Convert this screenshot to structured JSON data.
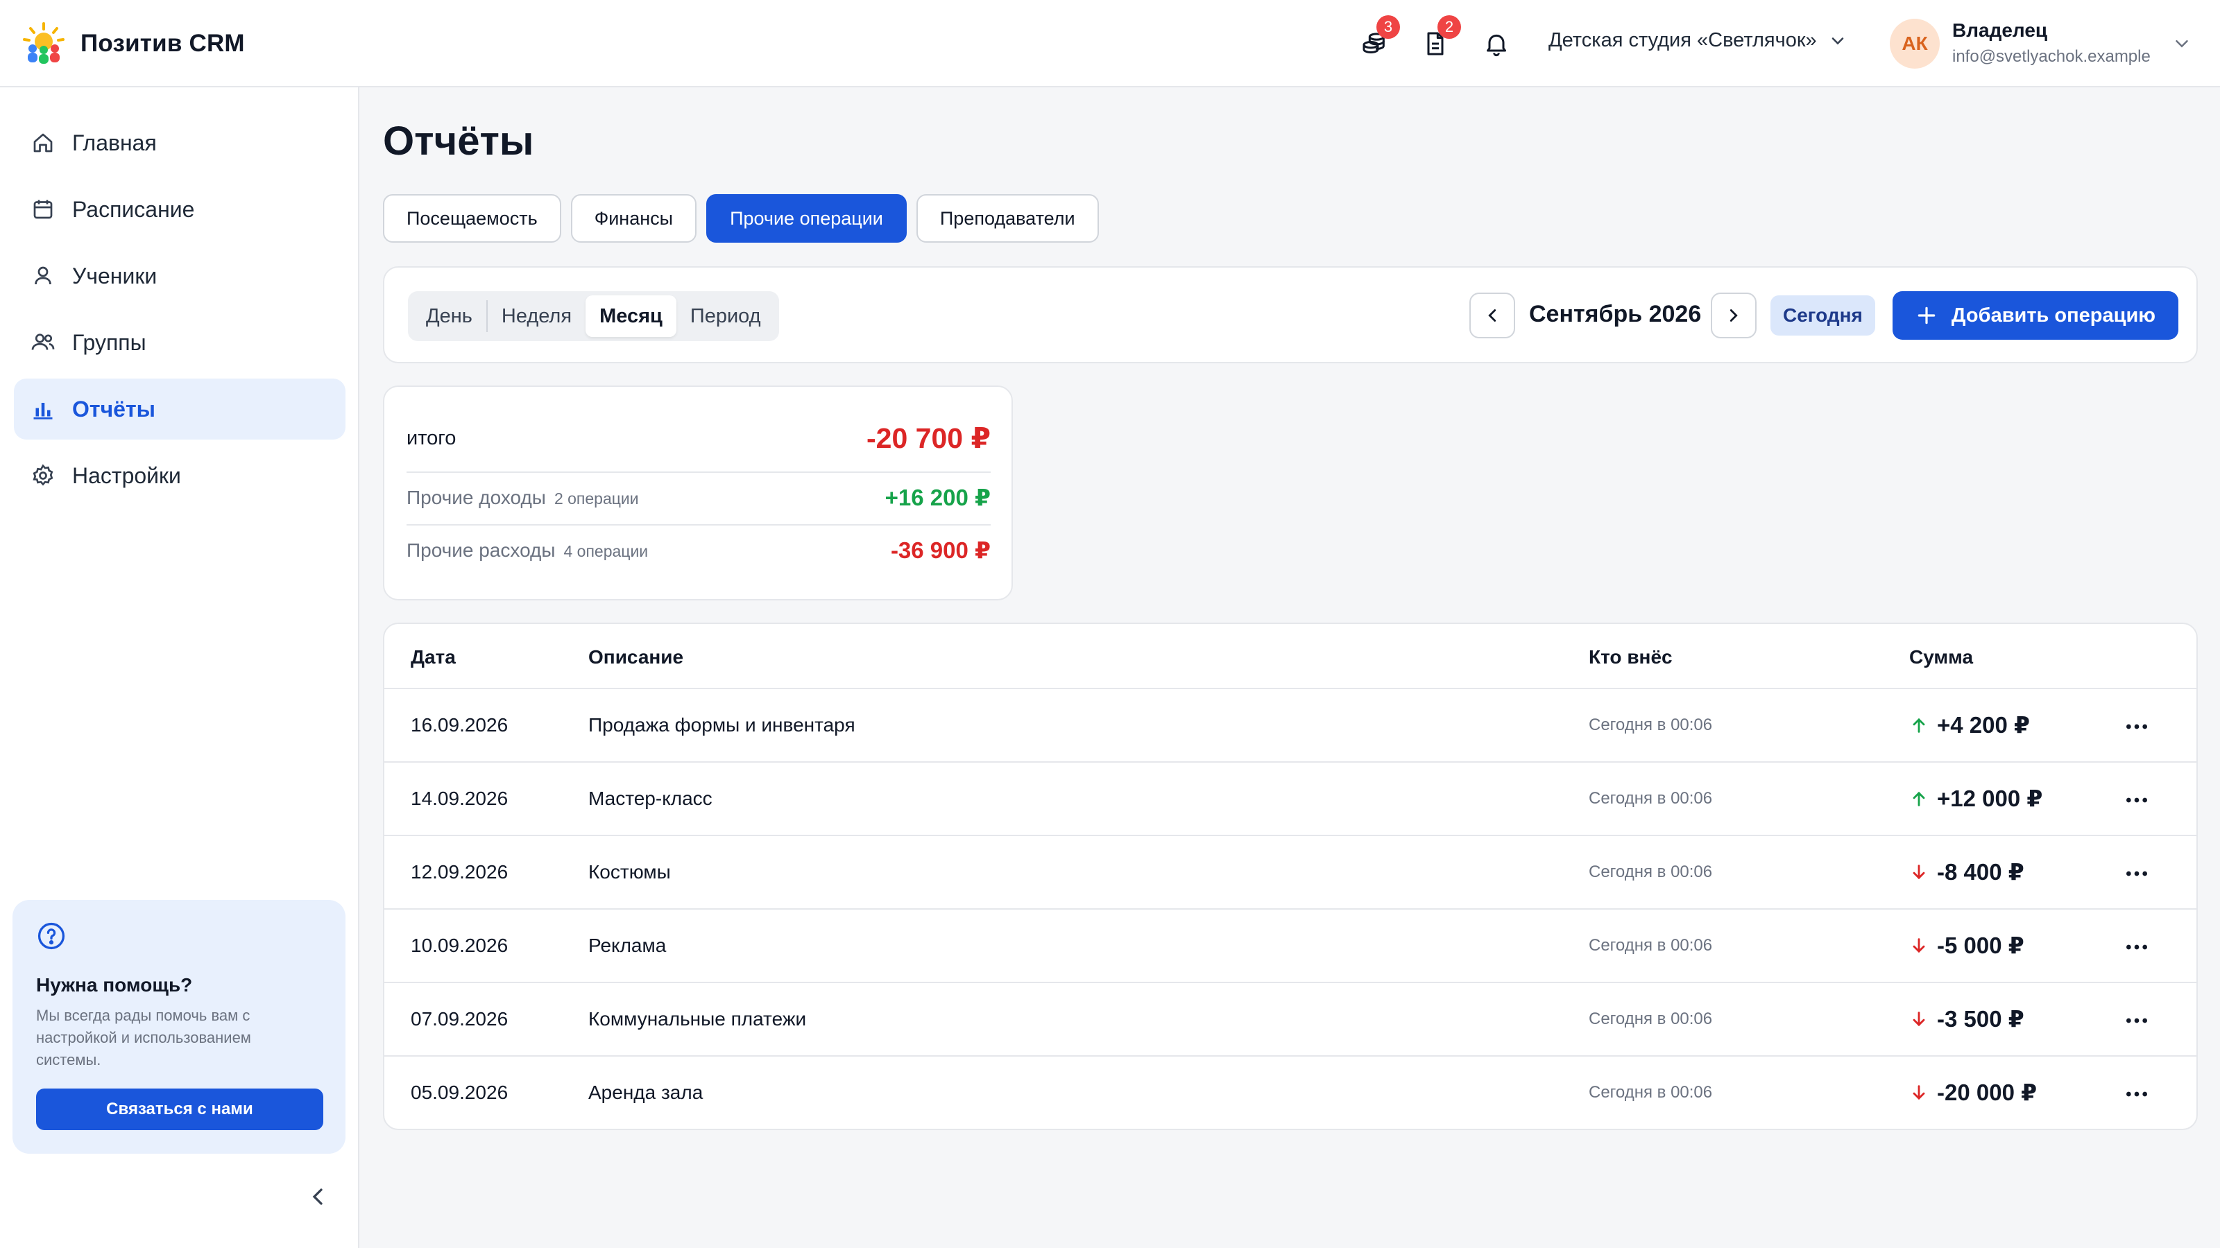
{
  "header": {
    "brand": "Позитив CRM",
    "badges": {
      "payments": "3",
      "documents": "2"
    },
    "studio": "Детская студия «Светлячок»",
    "avatar_initials": "АК",
    "user_name": "Владелец",
    "user_email": "info@svetlyachok.example"
  },
  "sidebar": {
    "items": [
      {
        "label": "Главная",
        "icon": "home-icon"
      },
      {
        "label": "Расписание",
        "icon": "calendar-icon"
      },
      {
        "label": "Ученики",
        "icon": "user-icon"
      },
      {
        "label": "Группы",
        "icon": "users-icon"
      },
      {
        "label": "Отчёты",
        "icon": "chart-icon"
      },
      {
        "label": "Настройки",
        "icon": "gear-icon"
      }
    ],
    "active_index": 4,
    "help": {
      "title": "Нужна помощь?",
      "text": "Мы всегда рады помочь вам с настройкой и использованием системы.",
      "button": "Связаться с нами"
    }
  },
  "page": {
    "title": "Отчёты",
    "tabs": [
      "Посещаемость",
      "Финансы",
      "Прочие операции",
      "Преподаватели"
    ],
    "active_tab": 2
  },
  "toolbar": {
    "periods": [
      "День",
      "Неделя",
      "Месяц",
      "Период"
    ],
    "active_period": 2,
    "month": "Сентябрь 2026",
    "today": "Сегодня",
    "add": "Добавить операцию"
  },
  "summary": {
    "total_label": "итого",
    "total_value": "-20 700 ₽",
    "income_label": "Прочие доходы",
    "income_count": "2 операции",
    "income_value": "+16 200 ₽",
    "expense_label": "Прочие расходы",
    "expense_count": "4 операции",
    "expense_value": "-36 900 ₽"
  },
  "table": {
    "columns": [
      "Дата",
      "Описание",
      "Кто внёс",
      "Сумма"
    ],
    "rows": [
      {
        "date": "16.09.2026",
        "desc": "Продажа формы и инвентаря",
        "by": "Сегодня в 00:06",
        "amount": "+4 200 ₽",
        "dir": "up"
      },
      {
        "date": "14.09.2026",
        "desc": "Мастер-класс",
        "by": "Сегодня в 00:06",
        "amount": "+12 000 ₽",
        "dir": "up"
      },
      {
        "date": "12.09.2026",
        "desc": "Костюмы",
        "by": "Сегодня в 00:06",
        "amount": "-8 400 ₽",
        "dir": "down"
      },
      {
        "date": "10.09.2026",
        "desc": "Реклама",
        "by": "Сегодня в 00:06",
        "amount": "-5 000 ₽",
        "dir": "down"
      },
      {
        "date": "07.09.2026",
        "desc": "Коммунальные платежи",
        "by": "Сегодня в 00:06",
        "amount": "-3 500 ₽",
        "dir": "down"
      },
      {
        "date": "05.09.2026",
        "desc": "Аренда зала",
        "by": "Сегодня в 00:06",
        "amount": "-20 000 ₽",
        "dir": "down"
      }
    ]
  },
  "colors": {
    "accent": "#1a56db",
    "positive": "#16a34a",
    "negative": "#dc2626"
  }
}
